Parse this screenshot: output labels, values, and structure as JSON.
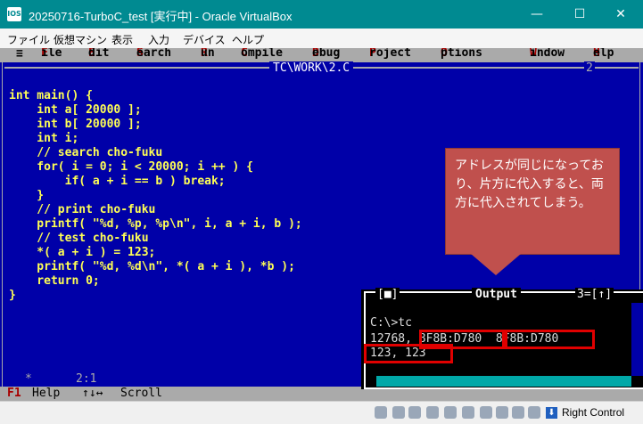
{
  "window": {
    "icon_label": "IOS",
    "title": "20250716-TurboC_test [実行中] - Oracle VirtualBox",
    "minimize": "—",
    "maximize": "☐",
    "close": "✕"
  },
  "vbox_menu": [
    "ファイル",
    "仮想マシン",
    "表示",
    "入力",
    "デバイス",
    "ヘルプ"
  ],
  "tc_menu": {
    "system": "≡",
    "items": [
      {
        "hot": "F",
        "rest": "ile"
      },
      {
        "hot": "E",
        "rest": "dit"
      },
      {
        "hot": "S",
        "rest": "earch"
      },
      {
        "hot": "R",
        "rest": "un"
      },
      {
        "hot": "C",
        "rest": "ompile"
      },
      {
        "hot": "D",
        "rest": "ebug"
      },
      {
        "hot": "P",
        "rest": "roject"
      },
      {
        "hot": "O",
        "rest": "ptions"
      },
      {
        "hot": "W",
        "rest": "indow"
      },
      {
        "hot": "H",
        "rest": "elp"
      }
    ]
  },
  "editor": {
    "filename": "TC\\WORK\\2.C",
    "window_number": "2",
    "lines": [
      "int main() {",
      "    int a[ 20000 ];",
      "    int b[ 20000 ];",
      "",
      "    int i;",
      "",
      "    // search cho-fuku",
      "    for( i = 0; i < 20000; i ++ ) {",
      "        if( a + i == b ) break;",
      "    }",
      "",
      "    // print cho-fuku",
      "    printf( \"%d, %p, %p\\n\", i, a + i, b );",
      "",
      "    // test cho-fuku",
      "    *( a + i ) = 123;",
      "    printf( \"%d, %d\\n\", *( a + i ), *b );",
      "",
      "    return 0;",
      "}"
    ],
    "status_star": "*",
    "cursor_pos": "2:1"
  },
  "output": {
    "title": "Output",
    "bracket": "[■]",
    "number_label": "3=[↑]",
    "lines": [
      "C:\\>tc",
      "12768, 8F8B:D780  8F8B:D780",
      "123, 123"
    ]
  },
  "helpbar": {
    "key": "F1",
    "help": "Help",
    "scroll_keys": "↑↓↔",
    "scroll": "Scroll"
  },
  "callout": {
    "text": "アドレスが同じになっており、片方に代入すると、両方に代入されてしまう。"
  },
  "vbox_status": {
    "host_key": "Right Control"
  },
  "colors": {
    "titlebar": "#008a91",
    "tc_blue": "#0000a8",
    "code_yellow": "#ffff55",
    "highlight_red": "#e00000",
    "callout": "#c0504d"
  }
}
